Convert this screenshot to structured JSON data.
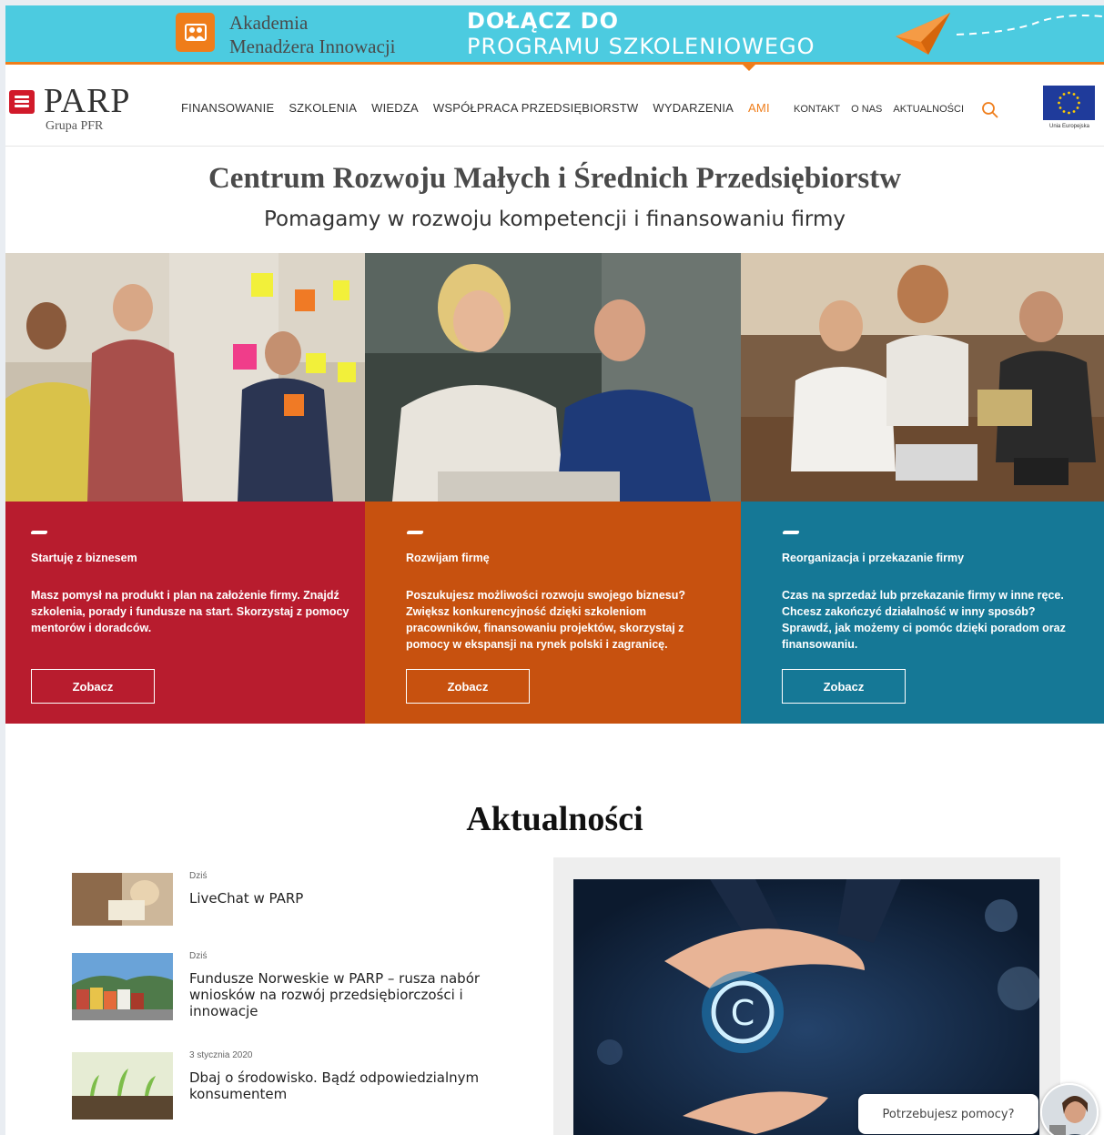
{
  "banner": {
    "ami_line1": "Akademia",
    "ami_line2": "Menadżera Innowacji",
    "cta_line1": "DOŁĄCZ DO",
    "cta_line2": "PROGRAMU SZKOLENIOWEGO",
    "bg_color": "#4ccbe0",
    "accent_color": "#ef7d1a"
  },
  "logo": {
    "name": "PARP",
    "sub": "Grupa PFR",
    "brand_color": "#d11a2a"
  },
  "nav": {
    "main": [
      "FINANSOWANIE",
      "SZKOLENIA",
      "WIEDZA",
      "WSPÓŁPRACA PRZEDSIĘBIORSTW",
      "WYDARZENIA",
      "AMI"
    ],
    "secondary": [
      "KONTAKT",
      "O NAS",
      "AKTUALNOŚCI"
    ],
    "eu_label": "Unia Europejska"
  },
  "hero": {
    "title": "Centrum Rozwoju Małych i Średnich Przedsiębiorstw",
    "subtitle": "Pomagamy w rozwoju kompetencji i finansowaniu firmy"
  },
  "cards": [
    {
      "title": "Startuję z biznesem",
      "desc": "Masz pomysł na produkt i plan na założenie firmy. Znajdź szkolenia, porady i fundusze na start. Skorzystaj z pomocy mentorów i doradców.",
      "button": "Zobacz",
      "color": "#b81c2e"
    },
    {
      "title": "Rozwijam firmę",
      "desc": "Poszukujesz możliwości rozwoju swojego biznesu? Zwiększ konkurencyjność dzięki szkoleniom pracowników, finansowaniu projektów, skorzystaj z pomocy w ekspansji na rynek polski i zagranicę.",
      "button": "Zobacz",
      "color": "#c7510f"
    },
    {
      "title": "Reorganizacja i przekazanie firmy",
      "desc": "Czas na sprzedaż lub przekazanie firmy w inne ręce. Chcesz zakończyć działalność w inny sposób? Sprawdź, jak możemy ci pomóc dzięki poradom oraz finansowaniu.",
      "button": "Zobacz",
      "color": "#157896"
    }
  ],
  "news": {
    "title": "Aktualności",
    "items": [
      {
        "date": "Dziś",
        "title": "LiveChat w PARP"
      },
      {
        "date": "Dziś",
        "title": "Fundusze Norweskie w PARP – rusza nabór wniosków na rozwój przedsiębiorczości i innowacje"
      },
      {
        "date": "3 stycznia 2020",
        "title": "Dbaj o środowisko. Bądź odpowiedzialnym konsumentem"
      }
    ]
  },
  "chat": {
    "prompt": "Potrzebujesz pomocy?"
  }
}
